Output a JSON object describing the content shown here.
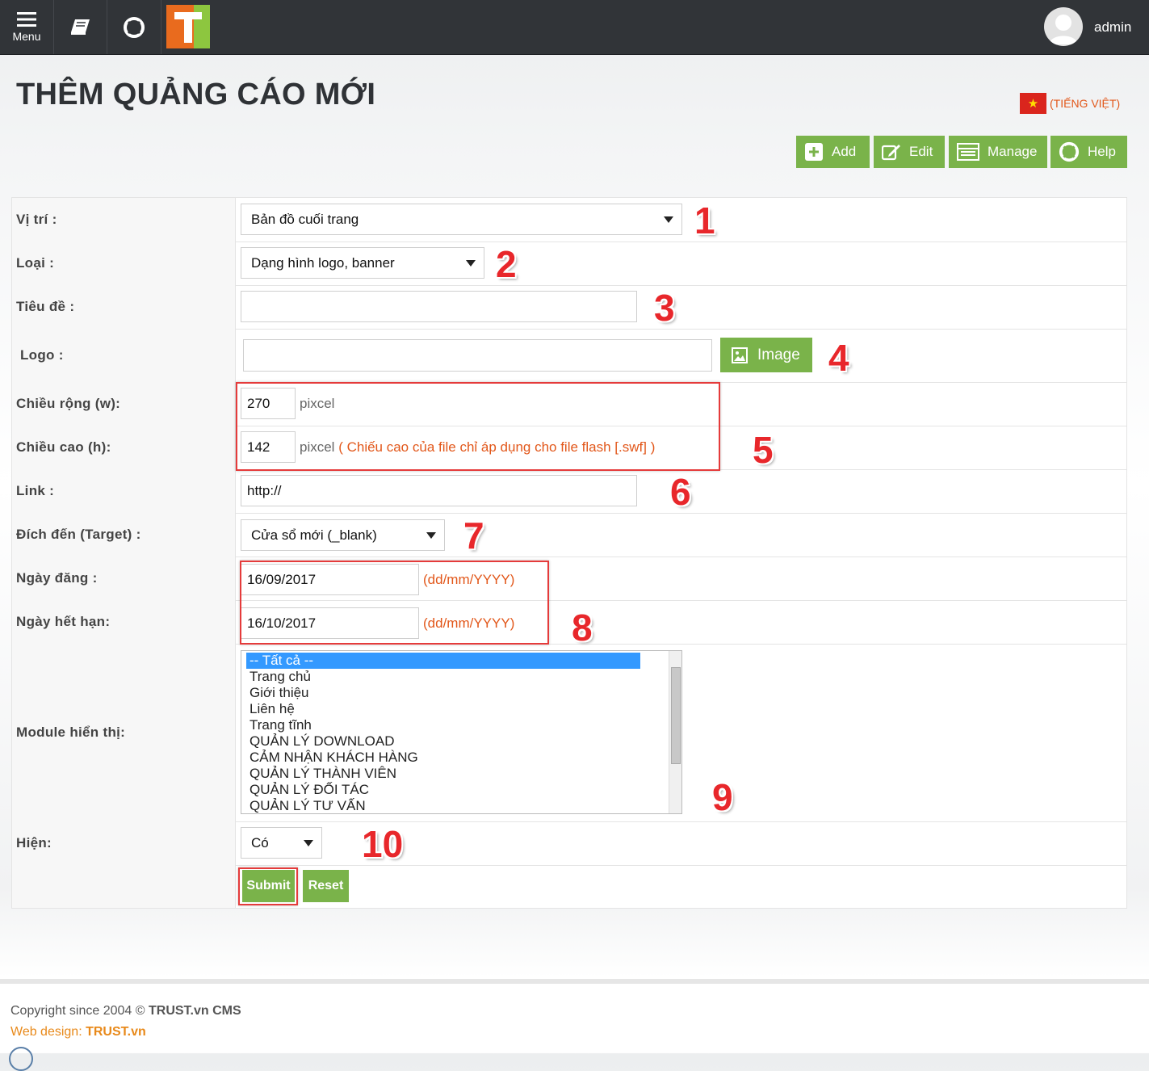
{
  "topbar": {
    "menu_label": "Menu",
    "logo_letter": "T",
    "username": "admin"
  },
  "page": {
    "title": "THÊM QUẢNG CÁO MỚI",
    "language": "(TIẾNG VIỆT)"
  },
  "toolbar": {
    "add": "Add",
    "edit": "Edit",
    "manage": "Manage",
    "help": "Help"
  },
  "form": {
    "position": {
      "label": "Vị trí :",
      "value": "Bản đồ cuối trang"
    },
    "type": {
      "label": "Loại :",
      "value": "Dạng hình logo, banner"
    },
    "title": {
      "label": "Tiêu đề :",
      "value": ""
    },
    "logo": {
      "label": "Logo :",
      "value": "",
      "button": "Image"
    },
    "width": {
      "label": "Chiều rộng (w):",
      "value": "270",
      "unit": "pixcel"
    },
    "height": {
      "label": "Chiều cao (h):",
      "value": "142",
      "unit": "pixcel",
      "note": "( Chiếu cao của file chỉ áp dụng cho file flash [.swf] )"
    },
    "link": {
      "label": "Link :",
      "value": "http://"
    },
    "target": {
      "label": "Đích đến (Target) :",
      "value": "Cửa sổ mới (_blank)"
    },
    "post_date": {
      "label": "Ngày đăng :",
      "value": "16/09/2017",
      "hint": "(dd/mm/YYYY)"
    },
    "expire_date": {
      "label": "Ngày hết hạn:",
      "value": "16/10/2017",
      "hint": "(dd/mm/YYYY)"
    },
    "modules": {
      "label": "Module hiển thị:",
      "options": [
        "-- Tất cả --",
        "Trang chủ",
        "Giới thiệu",
        "Liên hệ",
        "Trang tĩnh",
        "QUẢN LÝ DOWNLOAD",
        "CẢM NHẬN KHÁCH HÀNG",
        "QUẢN LÝ THÀNH VIÊN",
        "QUẢN LÝ ĐỐI TÁC",
        "QUẢN LÝ TƯ VẤN"
      ],
      "selected_index": 0
    },
    "visible": {
      "label": "Hiện:",
      "value": "Có"
    },
    "submit": "Submit",
    "reset": "Reset"
  },
  "annotations": [
    "1",
    "2",
    "3",
    "4",
    "5",
    "6",
    "7",
    "8",
    "9",
    "10"
  ],
  "footer": {
    "copyright_prefix": "Copyright since 2004 © ",
    "copyright_brand": "TRUST.vn CMS",
    "webdesign_prefix": "Web design: ",
    "webdesign_brand": "TRUST.vn"
  },
  "colors": {
    "accent_green": "#7ab34a",
    "topbar": "#313438",
    "highlight_orange": "#e2571a",
    "annotation_red": "#e8272b"
  }
}
